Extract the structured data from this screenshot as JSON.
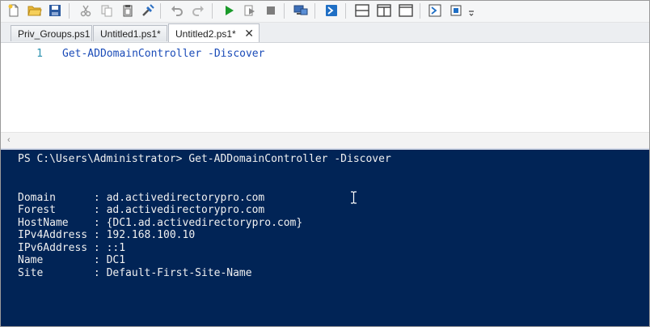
{
  "toolbar": {
    "icons": [
      "new-file-icon",
      "open-folder-icon",
      "save-icon",
      "cut-icon",
      "copy-icon",
      "paste-icon",
      "clear-icon",
      "undo-icon",
      "redo-icon",
      "run-icon",
      "run-selection-icon",
      "stop-icon",
      "remote-powershell-icon",
      "powershell-console-icon",
      "layout-top-icon",
      "layout-right-icon",
      "layout-max-icon",
      "show-command-icon",
      "show-addon-icon",
      "overflow-icon"
    ],
    "colors": {
      "run": "#1a9a2a",
      "save": "#2c5aa0",
      "powershell": "#1f6fc5"
    }
  },
  "tabs": [
    {
      "label": "Priv_Groups.ps1",
      "active": false
    },
    {
      "label": "Untitled1.ps1*",
      "active": false
    },
    {
      "label": "Untitled2.ps1*",
      "active": true,
      "close": "✕"
    }
  ],
  "editor": {
    "line_number": "1",
    "code": "Get-ADDomainController -Discover"
  },
  "console": {
    "prompt": "PS C:\\Users\\Administrator> Get-ADDomainController -Discover",
    "lines": [
      "Domain      : ad.activedirectorypro.com",
      "Forest      : ad.activedirectorypro.com",
      "HostName    : {DC1.ad.activedirectorypro.com}",
      "IPv4Address : 192.168.100.10",
      "IPv6Address : ::1",
      "Name        : DC1",
      "Site        : Default-First-Site-Name"
    ],
    "background": "#012456"
  }
}
